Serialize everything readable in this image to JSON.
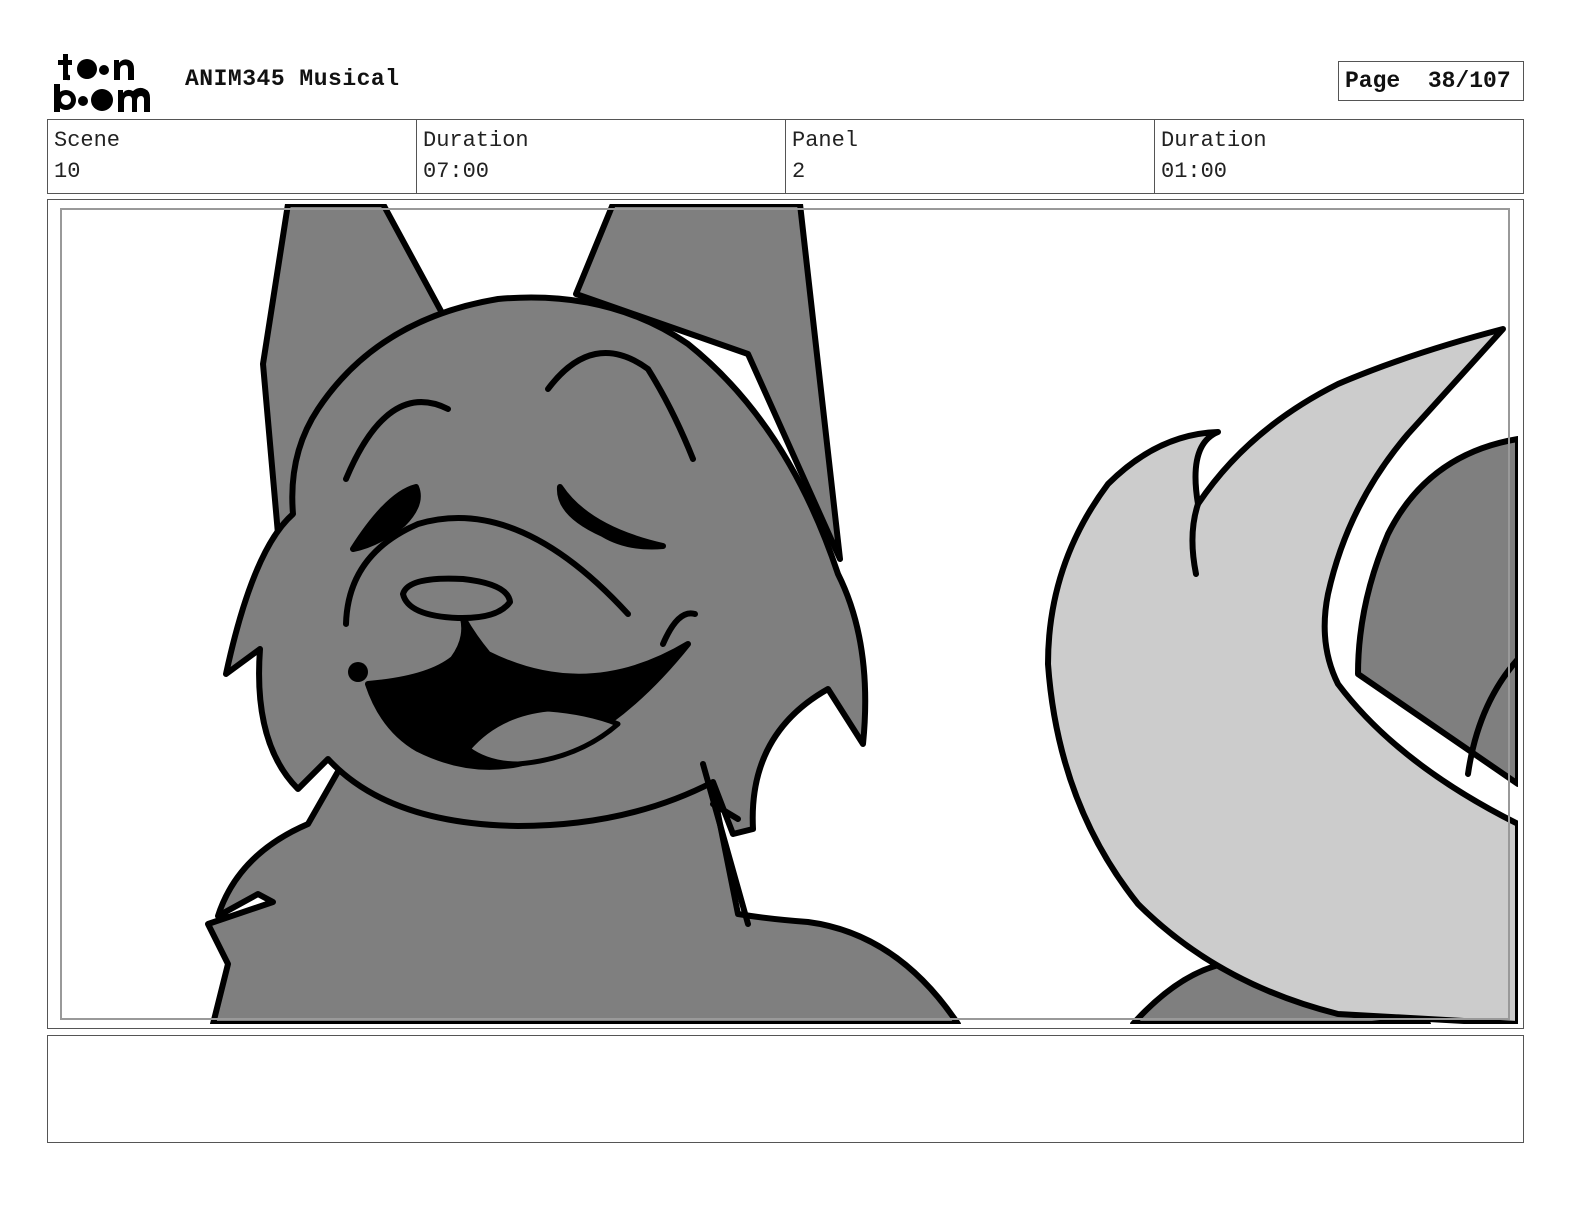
{
  "header": {
    "logo_text": "toon boom",
    "project_title": "ANIM345 Musical",
    "page_label": "Page  38/107"
  },
  "info": {
    "scene_label": "Scene",
    "scene_value": "10",
    "scene_duration_label": "Duration",
    "scene_duration_value": "07:00",
    "panel_label": "Panel",
    "panel_value": "2",
    "panel_duration_label": "Duration",
    "panel_duration_value": "01:00"
  },
  "colors": {
    "character_fill": "#7f7f7f",
    "tail_fill": "#cccccc",
    "ink": "#000000",
    "frame": "#555555"
  },
  "notes": {
    "text": ""
  }
}
